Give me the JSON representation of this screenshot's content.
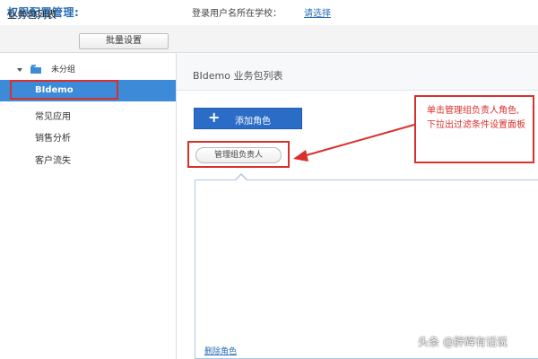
{
  "header": {
    "app_title": "权限配置管理:",
    "login_label": "登录用户名所在学校：",
    "login_select": "请选择"
  },
  "subbar": {
    "title": "业务包列表",
    "batch_button": "批量设置"
  },
  "sidebar": {
    "root_label": "未分组",
    "selected_item": "BIdemo",
    "items": [
      "常见应用",
      "销售分析",
      "客户流失"
    ]
  },
  "main": {
    "title": "BIdemo 业务包列表",
    "add_role_label": "添加角色",
    "manage_button": "管理组负责人",
    "delete_role": "删除角色"
  },
  "annotation": {
    "text": "单击管理组负责人角色,下拉出过滤条件设置面板"
  },
  "watermark": {
    "brand": "头条",
    "handle": "@胖辉有话说"
  },
  "colors": {
    "accent_blue": "#2b6cc6",
    "selected_bg": "#3d8ad8",
    "highlight_red": "#d9302d",
    "link_blue": "#2a6fb5"
  },
  "icons": {
    "add_role": "plus-icon",
    "tree_root": "folder-icon",
    "tree_toggle": "caret-down-icon"
  }
}
